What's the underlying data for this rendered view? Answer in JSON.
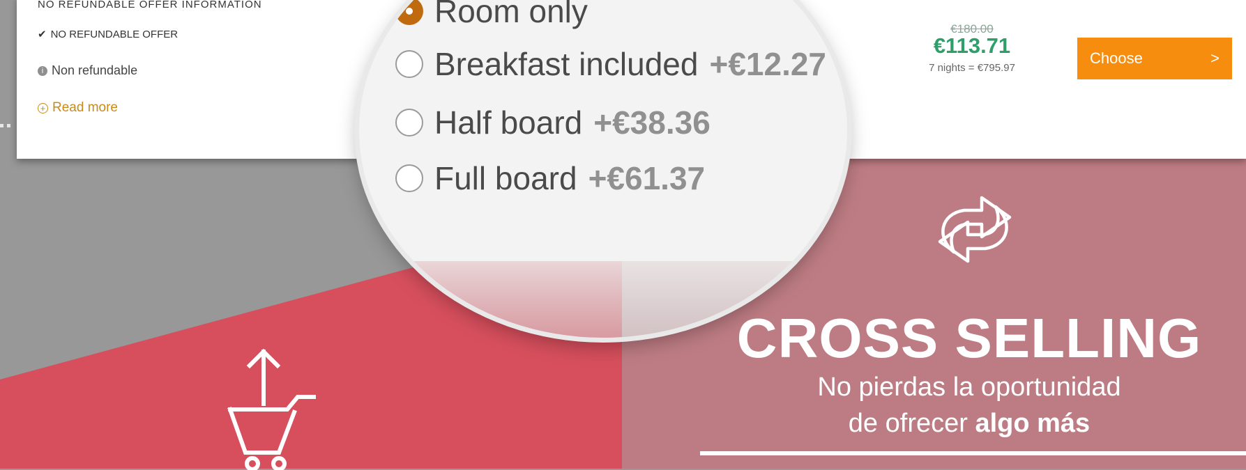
{
  "offer": {
    "cut_text": "NO REFUNDABLE OFFER INFORMATION",
    "refundable_label": "NO REFUNDABLE OFFER",
    "refund_status": "Non refundable",
    "read_more": "Read more",
    "price_old": "€180.00",
    "price_new": "€113.71",
    "nights_total": "7 nights = €795.97",
    "choose_label": "Choose",
    "choose_arrow": ">"
  },
  "board_options": [
    {
      "label": "Room only",
      "extra": "",
      "selected": true
    },
    {
      "label": "Breakfast included",
      "extra": "+€12.27",
      "selected": false
    },
    {
      "label": "Half board",
      "extra": "+€38.36",
      "selected": false
    },
    {
      "label": "Full board",
      "extra": "+€61.37",
      "selected": false
    }
  ],
  "promo": {
    "title": "CROSS SELLING",
    "subtitle_line1": "No pierdas la oportunidad",
    "subtitle_line2_plain": "de ofrecer ",
    "subtitle_line2_bold": "algo más"
  },
  "icons": {
    "cross": "repeat-arrows-icon",
    "cart": "upload-cart-icon",
    "check": "check-icon",
    "info": "info-icon",
    "plus": "plus-circle-icon"
  },
  "colors": {
    "accent_orange": "#f68d0e",
    "price_green": "#2f9e6a",
    "read_more_gold": "#c98a17",
    "red_panel": "#d74f5d",
    "pink_panel": "#bd7c83",
    "grey_background": "#989898"
  }
}
